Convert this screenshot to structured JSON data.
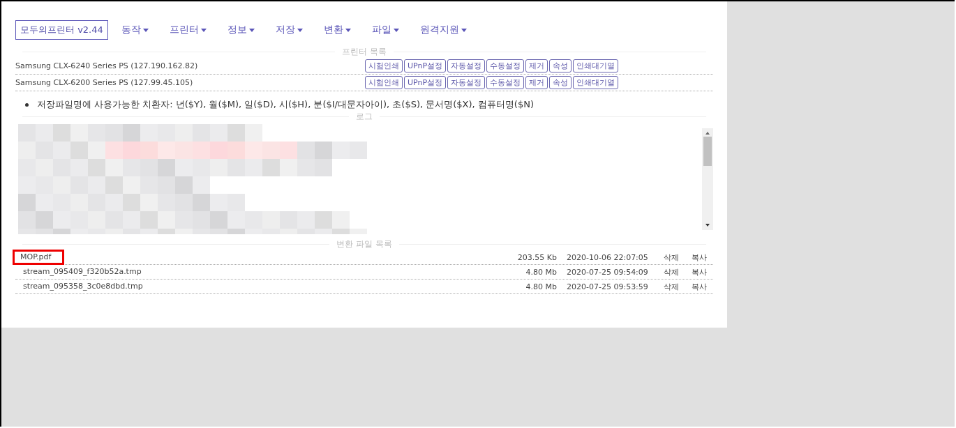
{
  "brand": "모두의프린터 v2.44",
  "menu": [
    {
      "label": "동작"
    },
    {
      "label": "프린터"
    },
    {
      "label": "정보"
    },
    {
      "label": "저장"
    },
    {
      "label": "변환"
    },
    {
      "label": "파일"
    },
    {
      "label": "원격지원"
    }
  ],
  "printers": {
    "title": "프린터 목록",
    "rows": [
      {
        "name": "Samsung CLX-6240 Series PS (127.190.162.82)",
        "buttons": [
          "시험인쇄",
          "UPnP설정",
          "자동설정",
          "수동설정",
          "제거",
          "속성",
          "인쇄대기열"
        ]
      },
      {
        "name": "Samsung CLX-6200 Series PS (127.99.45.105)",
        "buttons": [
          "시험인쇄",
          "UPnP설정",
          "자동설정",
          "수동설정",
          "제거",
          "속성",
          "인쇄대기열"
        ]
      }
    ]
  },
  "note": "저장파일명에 사용가능한 치환자: 년($Y), 월($M), 일($D), 시($H), 분($I/대문자아이), 초($S), 문서명($X), 컴퓨터명($N)",
  "log": {
    "title": "로그"
  },
  "files": {
    "title": "변환 파일 목록",
    "rows": [
      {
        "name": "MOP.pdf",
        "size": "203.55 Kb",
        "date": "2020-10-06 22:07:05",
        "delete": "삭제",
        "copy": "복사",
        "highlighted": true
      },
      {
        "name": "stream_095409_f320b52a.tmp",
        "size": "4.80 Mb",
        "date": "2020-07-25 09:54:09",
        "delete": "삭제",
        "copy": "복사",
        "highlighted": false
      },
      {
        "name": "stream_095358_3c0e8dbd.tmp",
        "size": "4.80 Mb",
        "date": "2020-07-25 09:53:59",
        "delete": "삭제",
        "copy": "복사",
        "highlighted": false
      }
    ]
  }
}
